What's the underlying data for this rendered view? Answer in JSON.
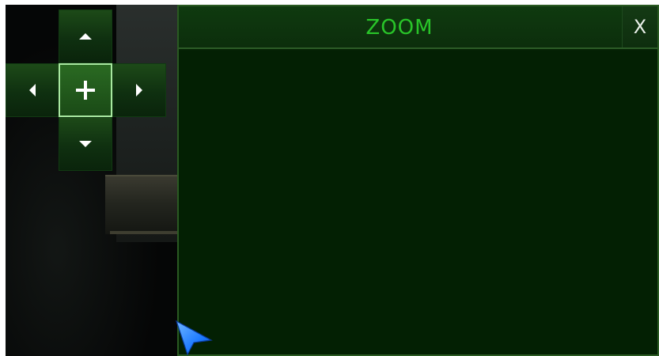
{
  "zoom_panel": {
    "title": "ZOOM",
    "close_label": "X"
  },
  "dpad": {
    "up_icon": "arrow-up-icon",
    "down_icon": "arrow-down-icon",
    "left_icon": "arrow-left-icon",
    "right_icon": "arrow-right-icon",
    "center_icon": "plus-icon"
  },
  "colors": {
    "title_green": "#29c429",
    "panel_bg": "#032003",
    "dpad_green": "#1d4a18",
    "dpad_selected_border": "#a8e8a0",
    "cursor_blue": "#1e7bff"
  },
  "cursor": {
    "icon": "mouse-pointer-icon"
  }
}
